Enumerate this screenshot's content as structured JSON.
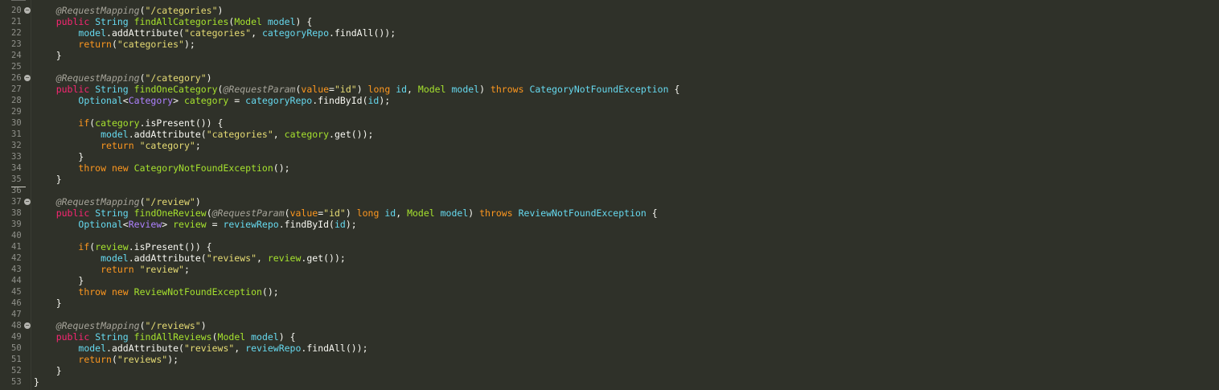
{
  "editor": {
    "lines": [
      {
        "n": "20",
        "fold": true,
        "tokens": [
          {
            "t": "    ",
            "c": "plain"
          },
          {
            "t": "@RequestMapping",
            "c": "ann"
          },
          {
            "t": "(",
            "c": "plain"
          },
          {
            "t": "\"/categories\"",
            "c": "str"
          },
          {
            "t": ")",
            "c": "plain"
          }
        ]
      },
      {
        "n": "21",
        "fold": false,
        "tokens": [
          {
            "t": "    ",
            "c": "plain"
          },
          {
            "t": "public",
            "c": "ctl"
          },
          {
            "t": " ",
            "c": "plain"
          },
          {
            "t": "String",
            "c": "cyan"
          },
          {
            "t": " ",
            "c": "plain"
          },
          {
            "t": "findAllCategories",
            "c": "method"
          },
          {
            "t": "(",
            "c": "plain"
          },
          {
            "t": "Model",
            "c": "type"
          },
          {
            "t": " ",
            "c": "plain"
          },
          {
            "t": "model",
            "c": "cyan"
          },
          {
            "t": ") {",
            "c": "plain"
          }
        ]
      },
      {
        "n": "22",
        "fold": false,
        "tokens": [
          {
            "t": "        ",
            "c": "plain"
          },
          {
            "t": "model",
            "c": "cyan"
          },
          {
            "t": ".",
            "c": "plain"
          },
          {
            "t": "addAttribute",
            "c": "plain"
          },
          {
            "t": "(",
            "c": "plain"
          },
          {
            "t": "\"categories\"",
            "c": "str"
          },
          {
            "t": ", ",
            "c": "plain"
          },
          {
            "t": "categoryRepo",
            "c": "cyan"
          },
          {
            "t": ".",
            "c": "plain"
          },
          {
            "t": "findAll",
            "c": "plain"
          },
          {
            "t": "());",
            "c": "plain"
          }
        ]
      },
      {
        "n": "23",
        "fold": false,
        "tokens": [
          {
            "t": "        ",
            "c": "plain"
          },
          {
            "t": "return",
            "c": "orange"
          },
          {
            "t": "(",
            "c": "plain"
          },
          {
            "t": "\"categories\"",
            "c": "str"
          },
          {
            "t": ");",
            "c": "plain"
          }
        ]
      },
      {
        "n": "24",
        "fold": false,
        "tokens": [
          {
            "t": "    }",
            "c": "plain"
          }
        ]
      },
      {
        "n": "25",
        "fold": false,
        "tokens": []
      },
      {
        "n": "26",
        "fold": true,
        "tokens": [
          {
            "t": "    ",
            "c": "plain"
          },
          {
            "t": "@RequestMapping",
            "c": "ann"
          },
          {
            "t": "(",
            "c": "plain"
          },
          {
            "t": "\"/category\"",
            "c": "str"
          },
          {
            "t": ")",
            "c": "plain"
          }
        ]
      },
      {
        "n": "27",
        "fold": false,
        "tokens": [
          {
            "t": "    ",
            "c": "plain"
          },
          {
            "t": "public",
            "c": "ctl"
          },
          {
            "t": " ",
            "c": "plain"
          },
          {
            "t": "String",
            "c": "cyan"
          },
          {
            "t": " ",
            "c": "plain"
          },
          {
            "t": "findOneCategory",
            "c": "method"
          },
          {
            "t": "(",
            "c": "plain"
          },
          {
            "t": "@RequestParam",
            "c": "ann"
          },
          {
            "t": "(",
            "c": "plain"
          },
          {
            "t": "value",
            "c": "orange"
          },
          {
            "t": "=",
            "c": "plain"
          },
          {
            "t": "\"id\"",
            "c": "str"
          },
          {
            "t": ") ",
            "c": "plain"
          },
          {
            "t": "long",
            "c": "orange"
          },
          {
            "t": " ",
            "c": "plain"
          },
          {
            "t": "id",
            "c": "cyan"
          },
          {
            "t": ", ",
            "c": "plain"
          },
          {
            "t": "Model",
            "c": "type"
          },
          {
            "t": " ",
            "c": "plain"
          },
          {
            "t": "model",
            "c": "cyan"
          },
          {
            "t": ") ",
            "c": "plain"
          },
          {
            "t": "throws",
            "c": "orange"
          },
          {
            "t": " ",
            "c": "plain"
          },
          {
            "t": "CategoryNotFoundException",
            "c": "cyan"
          },
          {
            "t": " {",
            "c": "plain"
          }
        ]
      },
      {
        "n": "28",
        "fold": false,
        "tokens": [
          {
            "t": "        ",
            "c": "plain"
          },
          {
            "t": "Optional",
            "c": "cyan"
          },
          {
            "t": "<",
            "c": "plain"
          },
          {
            "t": "Category",
            "c": "purple"
          },
          {
            "t": "> ",
            "c": "plain"
          },
          {
            "t": "category",
            "c": "type"
          },
          {
            "t": " = ",
            "c": "plain"
          },
          {
            "t": "categoryRepo",
            "c": "cyan"
          },
          {
            "t": ".",
            "c": "plain"
          },
          {
            "t": "findById",
            "c": "plain"
          },
          {
            "t": "(",
            "c": "plain"
          },
          {
            "t": "id",
            "c": "cyan"
          },
          {
            "t": ");",
            "c": "plain"
          }
        ]
      },
      {
        "n": "29",
        "fold": false,
        "tokens": []
      },
      {
        "n": "30",
        "fold": false,
        "tokens": [
          {
            "t": "        ",
            "c": "plain"
          },
          {
            "t": "if",
            "c": "orange"
          },
          {
            "t": "(",
            "c": "plain"
          },
          {
            "t": "category",
            "c": "type"
          },
          {
            "t": ".",
            "c": "plain"
          },
          {
            "t": "isPresent",
            "c": "plain"
          },
          {
            "t": "()) {",
            "c": "plain"
          }
        ]
      },
      {
        "n": "31",
        "fold": false,
        "tokens": [
          {
            "t": "            ",
            "c": "plain"
          },
          {
            "t": "model",
            "c": "cyan"
          },
          {
            "t": ".",
            "c": "plain"
          },
          {
            "t": "addAttribute",
            "c": "plain"
          },
          {
            "t": "(",
            "c": "plain"
          },
          {
            "t": "\"categories\"",
            "c": "str"
          },
          {
            "t": ", ",
            "c": "plain"
          },
          {
            "t": "category",
            "c": "type"
          },
          {
            "t": ".",
            "c": "plain"
          },
          {
            "t": "get",
            "c": "plain"
          },
          {
            "t": "());",
            "c": "plain"
          }
        ]
      },
      {
        "n": "32",
        "fold": false,
        "tokens": [
          {
            "t": "            ",
            "c": "plain"
          },
          {
            "t": "return",
            "c": "orange"
          },
          {
            "t": " ",
            "c": "plain"
          },
          {
            "t": "\"category\"",
            "c": "str"
          },
          {
            "t": ";",
            "c": "plain"
          }
        ]
      },
      {
        "n": "33",
        "fold": false,
        "tokens": [
          {
            "t": "        }",
            "c": "plain"
          }
        ]
      },
      {
        "n": "34",
        "fold": false,
        "tokens": [
          {
            "t": "        ",
            "c": "plain"
          },
          {
            "t": "throw",
            "c": "orange"
          },
          {
            "t": " ",
            "c": "plain"
          },
          {
            "t": "new",
            "c": "orange"
          },
          {
            "t": " ",
            "c": "plain"
          },
          {
            "t": "CategoryNotFoundException",
            "c": "type"
          },
          {
            "t": "();",
            "c": "plain"
          }
        ]
      },
      {
        "n": "35",
        "fold": false,
        "tokens": [
          {
            "t": "    }",
            "c": "plain"
          }
        ]
      },
      {
        "n": "36",
        "fold": false,
        "tokens": []
      },
      {
        "n": "37",
        "fold": true,
        "tokens": [
          {
            "t": "    ",
            "c": "plain"
          },
          {
            "t": "@RequestMapping",
            "c": "ann"
          },
          {
            "t": "(",
            "c": "plain"
          },
          {
            "t": "\"/review\"",
            "c": "str"
          },
          {
            "t": ")",
            "c": "plain"
          }
        ]
      },
      {
        "n": "38",
        "fold": false,
        "tokens": [
          {
            "t": "    ",
            "c": "plain"
          },
          {
            "t": "public",
            "c": "ctl"
          },
          {
            "t": " ",
            "c": "plain"
          },
          {
            "t": "String",
            "c": "cyan"
          },
          {
            "t": " ",
            "c": "plain"
          },
          {
            "t": "findOneReview",
            "c": "method"
          },
          {
            "t": "(",
            "c": "plain"
          },
          {
            "t": "@RequestParam",
            "c": "ann"
          },
          {
            "t": "(",
            "c": "plain"
          },
          {
            "t": "value",
            "c": "orange"
          },
          {
            "t": "=",
            "c": "plain"
          },
          {
            "t": "\"id\"",
            "c": "str"
          },
          {
            "t": ") ",
            "c": "plain"
          },
          {
            "t": "long",
            "c": "orange"
          },
          {
            "t": " ",
            "c": "plain"
          },
          {
            "t": "id",
            "c": "cyan"
          },
          {
            "t": ", ",
            "c": "plain"
          },
          {
            "t": "Model",
            "c": "type"
          },
          {
            "t": " ",
            "c": "plain"
          },
          {
            "t": "model",
            "c": "cyan"
          },
          {
            "t": ") ",
            "c": "plain"
          },
          {
            "t": "throws",
            "c": "orange"
          },
          {
            "t": " ",
            "c": "plain"
          },
          {
            "t": "ReviewNotFoundException",
            "c": "cyan"
          },
          {
            "t": " {",
            "c": "plain"
          }
        ]
      },
      {
        "n": "39",
        "fold": false,
        "tokens": [
          {
            "t": "        ",
            "c": "plain"
          },
          {
            "t": "Optional",
            "c": "cyan"
          },
          {
            "t": "<",
            "c": "plain"
          },
          {
            "t": "Review",
            "c": "purple"
          },
          {
            "t": "> ",
            "c": "plain"
          },
          {
            "t": "review",
            "c": "type"
          },
          {
            "t": " = ",
            "c": "plain"
          },
          {
            "t": "reviewRepo",
            "c": "cyan"
          },
          {
            "t": ".",
            "c": "plain"
          },
          {
            "t": "findById",
            "c": "plain"
          },
          {
            "t": "(",
            "c": "plain"
          },
          {
            "t": "id",
            "c": "cyan"
          },
          {
            "t": ");",
            "c": "plain"
          }
        ]
      },
      {
        "n": "40",
        "fold": false,
        "tokens": []
      },
      {
        "n": "41",
        "fold": false,
        "tokens": [
          {
            "t": "        ",
            "c": "plain"
          },
          {
            "t": "if",
            "c": "orange"
          },
          {
            "t": "(",
            "c": "plain"
          },
          {
            "t": "review",
            "c": "type"
          },
          {
            "t": ".",
            "c": "plain"
          },
          {
            "t": "isPresent",
            "c": "plain"
          },
          {
            "t": "()) {",
            "c": "plain"
          }
        ]
      },
      {
        "n": "42",
        "fold": false,
        "tokens": [
          {
            "t": "            ",
            "c": "plain"
          },
          {
            "t": "model",
            "c": "cyan"
          },
          {
            "t": ".",
            "c": "plain"
          },
          {
            "t": "addAttribute",
            "c": "plain"
          },
          {
            "t": "(",
            "c": "plain"
          },
          {
            "t": "\"reviews\"",
            "c": "str"
          },
          {
            "t": ", ",
            "c": "plain"
          },
          {
            "t": "review",
            "c": "type"
          },
          {
            "t": ".",
            "c": "plain"
          },
          {
            "t": "get",
            "c": "plain"
          },
          {
            "t": "());",
            "c": "plain"
          }
        ]
      },
      {
        "n": "43",
        "fold": false,
        "tokens": [
          {
            "t": "            ",
            "c": "plain"
          },
          {
            "t": "return",
            "c": "orange"
          },
          {
            "t": " ",
            "c": "plain"
          },
          {
            "t": "\"review\"",
            "c": "str"
          },
          {
            "t": ";",
            "c": "plain"
          }
        ]
      },
      {
        "n": "44",
        "fold": false,
        "tokens": [
          {
            "t": "        }",
            "c": "plain"
          }
        ]
      },
      {
        "n": "45",
        "fold": false,
        "tokens": [
          {
            "t": "        ",
            "c": "plain"
          },
          {
            "t": "throw",
            "c": "orange"
          },
          {
            "t": " ",
            "c": "plain"
          },
          {
            "t": "new",
            "c": "orange"
          },
          {
            "t": " ",
            "c": "plain"
          },
          {
            "t": "ReviewNotFoundException",
            "c": "type"
          },
          {
            "t": "();",
            "c": "plain"
          }
        ]
      },
      {
        "n": "46",
        "fold": false,
        "tokens": [
          {
            "t": "    }",
            "c": "plain"
          }
        ]
      },
      {
        "n": "47",
        "fold": false,
        "tokens": []
      },
      {
        "n": "48",
        "fold": true,
        "tokens": [
          {
            "t": "    ",
            "c": "plain"
          },
          {
            "t": "@RequestMapping",
            "c": "ann"
          },
          {
            "t": "(",
            "c": "plain"
          },
          {
            "t": "\"/reviews\"",
            "c": "str"
          },
          {
            "t": ")",
            "c": "plain"
          }
        ]
      },
      {
        "n": "49",
        "fold": false,
        "tokens": [
          {
            "t": "    ",
            "c": "plain"
          },
          {
            "t": "public",
            "c": "ctl"
          },
          {
            "t": " ",
            "c": "plain"
          },
          {
            "t": "String",
            "c": "cyan"
          },
          {
            "t": " ",
            "c": "plain"
          },
          {
            "t": "findAllReviews",
            "c": "method"
          },
          {
            "t": "(",
            "c": "plain"
          },
          {
            "t": "Model",
            "c": "type"
          },
          {
            "t": " ",
            "c": "plain"
          },
          {
            "t": "model",
            "c": "cyan"
          },
          {
            "t": ") {",
            "c": "plain"
          }
        ]
      },
      {
        "n": "50",
        "fold": false,
        "tokens": [
          {
            "t": "        ",
            "c": "plain"
          },
          {
            "t": "model",
            "c": "cyan"
          },
          {
            "t": ".",
            "c": "plain"
          },
          {
            "t": "addAttribute",
            "c": "plain"
          },
          {
            "t": "(",
            "c": "plain"
          },
          {
            "t": "\"reviews\"",
            "c": "str"
          },
          {
            "t": ", ",
            "c": "plain"
          },
          {
            "t": "reviewRepo",
            "c": "cyan"
          },
          {
            "t": ".",
            "c": "plain"
          },
          {
            "t": "findAll",
            "c": "plain"
          },
          {
            "t": "());",
            "c": "plain"
          }
        ]
      },
      {
        "n": "51",
        "fold": false,
        "tokens": [
          {
            "t": "        ",
            "c": "plain"
          },
          {
            "t": "return",
            "c": "orange"
          },
          {
            "t": "(",
            "c": "plain"
          },
          {
            "t": "\"reviews\"",
            "c": "str"
          },
          {
            "t": ");",
            "c": "plain"
          }
        ]
      },
      {
        "n": "52",
        "fold": false,
        "tokens": [
          {
            "t": "    }",
            "c": "plain"
          }
        ]
      },
      {
        "n": "53",
        "fold": false,
        "tokens": [
          {
            "t": "}",
            "c": "plain"
          }
        ]
      }
    ]
  },
  "colors": {
    "background": "#2f3129",
    "line_number": "#8f908a",
    "annotation": "#a6a49a",
    "keyword_pink": "#f92672",
    "string": "#e6db74",
    "type_green": "#a6e22e",
    "blue": "#66d9ef",
    "orange": "#fd971f",
    "purple": "#ae81ff",
    "plain": "#f8f8f2"
  },
  "icons": {
    "fold": "fold-collapse-icon"
  }
}
